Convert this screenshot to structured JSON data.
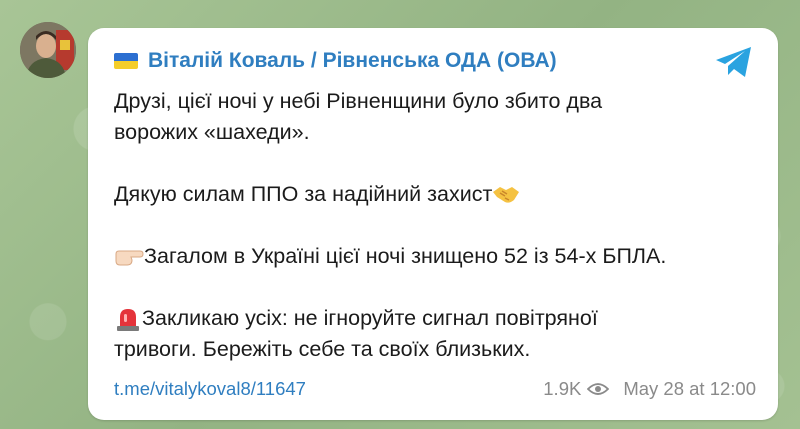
{
  "channel": {
    "name": "Віталій Коваль / Рівненська ОДА (ОВА)",
    "flag_colors": [
      "#2c6fd1",
      "#f4cd2a"
    ]
  },
  "message": {
    "p1_line1": "Друзі, цієї ночі у небі Рівненщини було збито два",
    "p1_line2": "ворожих «шахеди».",
    "p2": "Дякую силам ППО за надійний захист",
    "p3": "Загалом в Україні цієї ночі знищено 52 із 54-х БПЛА.",
    "p4_line1": "Закликаю усіх: не ігноруйте сигнал повітряної",
    "p4_line2": "тривоги. Бережіть себе та своїх близьких."
  },
  "footer": {
    "link": "t.me/vitalykoval8/11647",
    "views": "1.9K",
    "timestamp": "May 28 at 12:00"
  },
  "colors": {
    "accent": "#2f7ec0",
    "telegram": "#2aa3e0",
    "meta_text": "#8a8a8a"
  },
  "icons": [
    "ukraine-flag-icon",
    "telegram-icon",
    "handshake-emoji",
    "pointing-hand-emoji",
    "siren-emoji",
    "eye-icon"
  ]
}
